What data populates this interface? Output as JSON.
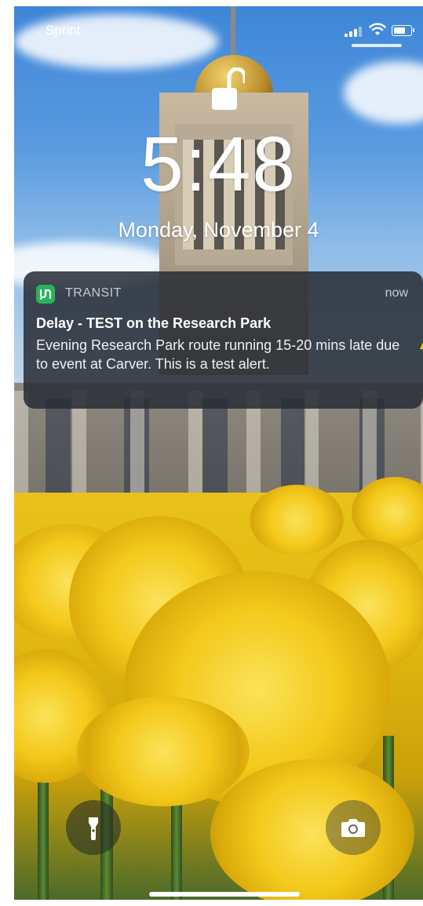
{
  "status_bar": {
    "carrier": "Sprint",
    "signal_icon": "cellular-signal-icon",
    "wifi_icon": "wifi-icon",
    "battery_icon": "battery-icon"
  },
  "lock_screen": {
    "lock_icon": "unlocked-padlock-icon",
    "time": "5:48",
    "date": "Monday, November 4"
  },
  "notification": {
    "app_icon": "transit-app-icon",
    "app_name": "TRANSIT",
    "timestamp": "now",
    "title": "Delay - TEST on the Research Park",
    "body": "Evening Research Park route running 15-20 mins late due to event at Carver. This is a test alert."
  },
  "quick_actions": {
    "flashlight_icon": "flashlight-icon",
    "camera_icon": "camera-icon"
  },
  "colors": {
    "transit_brand": "#29b35a",
    "notification_bg": "#2c3038",
    "accent": "#f3c91a"
  }
}
